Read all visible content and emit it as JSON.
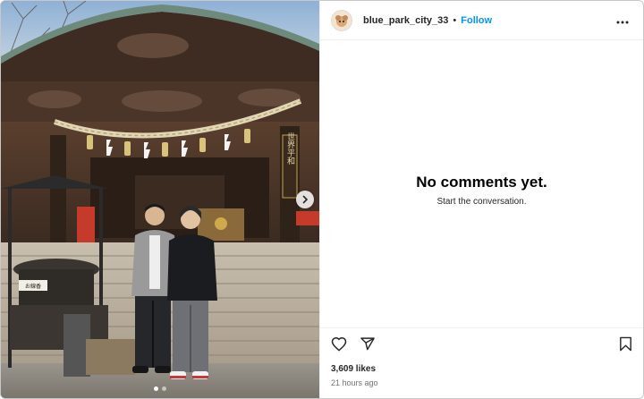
{
  "post": {
    "username": "blue_park_city_33",
    "separator": "•",
    "follow_label": "Follow",
    "more_icon": "more-horizontal-icon"
  },
  "comments": {
    "empty_title": "No comments yet.",
    "empty_subtitle": "Start the conversation."
  },
  "actions": {
    "like_icon": "heart-icon",
    "share_icon": "send-icon",
    "save_icon": "bookmark-icon",
    "likes_text": "3,609 likes",
    "timestamp": "21 hours ago"
  },
  "carousel": {
    "next_icon": "chevron-right-icon",
    "slide_count": 2,
    "active_slide": 1
  },
  "photo": {
    "description_icon": "temple-photo",
    "sign_text_1": "世界平和",
    "sign_text_2": "お線香"
  },
  "colors": {
    "accent": "#0095f6",
    "text": "#262626",
    "muted": "#737373",
    "border": "#efefef"
  }
}
